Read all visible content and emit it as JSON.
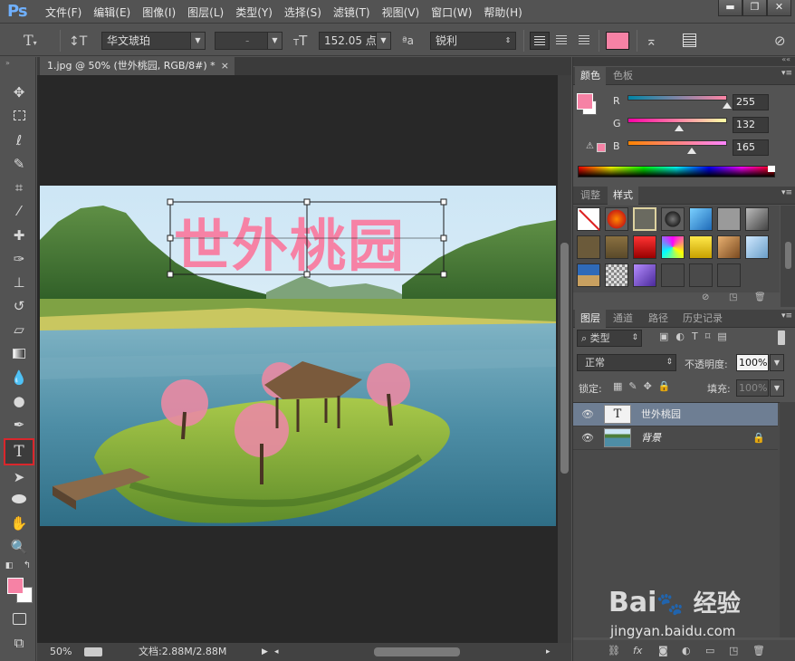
{
  "app": {
    "logo": "Ps",
    "menu": [
      "文件(F)",
      "编辑(E)",
      "图像(I)",
      "图层(L)",
      "类型(Y)",
      "选择(S)",
      "滤镜(T)",
      "视图(V)",
      "窗口(W)",
      "帮助(H)"
    ],
    "window_controls": [
      "▬",
      "❐",
      "✕"
    ]
  },
  "options": {
    "font_family": "华文琥珀",
    "font_style": "-",
    "font_size": "152.05 点",
    "antialias": "锐利",
    "text_color": "#f682a5"
  },
  "document": {
    "tab_title": "1.jpg @ 50% (世外桃园, RGB/8#) *",
    "text_on_canvas": "世外桃园",
    "text_color": "#f682a5"
  },
  "status": {
    "zoom": "50%",
    "doc_size": "文档:2.88M/2.88M"
  },
  "color_panel": {
    "tabs": [
      "颜色",
      "色板"
    ],
    "labels": [
      "R",
      "G",
      "B"
    ],
    "values": [
      "255",
      "132",
      "165"
    ],
    "levels": [
      1.0,
      0.518,
      0.647
    ],
    "fg": "#f682a5"
  },
  "styles_panel": {
    "tabs": [
      "调整",
      "样式"
    ]
  },
  "layers_panel": {
    "tabs": [
      "图层",
      "通道",
      "路径",
      "历史记录"
    ],
    "filter": "类型",
    "blend_mode": "正常",
    "opacity_label": "不透明度:",
    "opacity": "100%",
    "lock_label": "锁定:",
    "fill_label": "填充:",
    "fill": "100%",
    "layers": [
      {
        "name": "世外桃园",
        "thumb": "T",
        "selected": true
      },
      {
        "name": "背景",
        "thumb": "",
        "selected": false
      }
    ]
  },
  "watermark": {
    "brand": "Bai",
    "paw": "du",
    "cn": "经验",
    "url": "jingyan.baidu.com"
  }
}
